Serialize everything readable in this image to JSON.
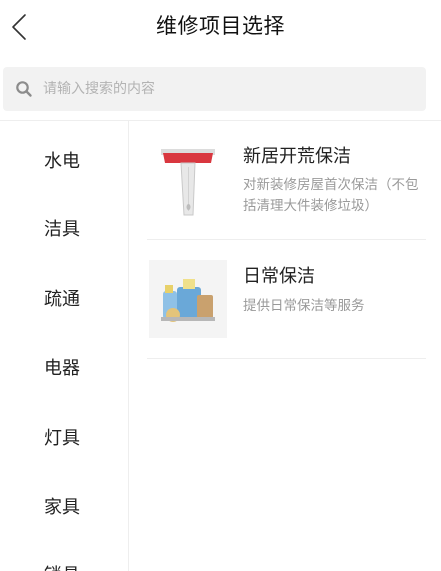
{
  "header": {
    "title": "维修项目选择",
    "back_icon": "chevron-left-icon"
  },
  "search": {
    "placeholder": "请输入搜索的内容",
    "icon": "search-icon"
  },
  "sidebar": {
    "items": [
      {
        "label": "水电"
      },
      {
        "label": "洁具"
      },
      {
        "label": "疏通"
      },
      {
        "label": "电器"
      },
      {
        "label": "灯具"
      },
      {
        "label": "家具"
      },
      {
        "label": "锁具"
      }
    ]
  },
  "items": [
    {
      "title": "新居开荒保洁",
      "desc": "对新装修房屋首次保洁（不包括清理大件装修垃圾）",
      "image": "scraper-tool-image"
    },
    {
      "title": "日常保洁",
      "desc": "提供日常保洁等服务",
      "image": "cleaning-supplies-image"
    }
  ],
  "colors": {
    "accent": "#d9373f",
    "divider": "#eeeeee",
    "muted_text": "#9a9a9a"
  }
}
